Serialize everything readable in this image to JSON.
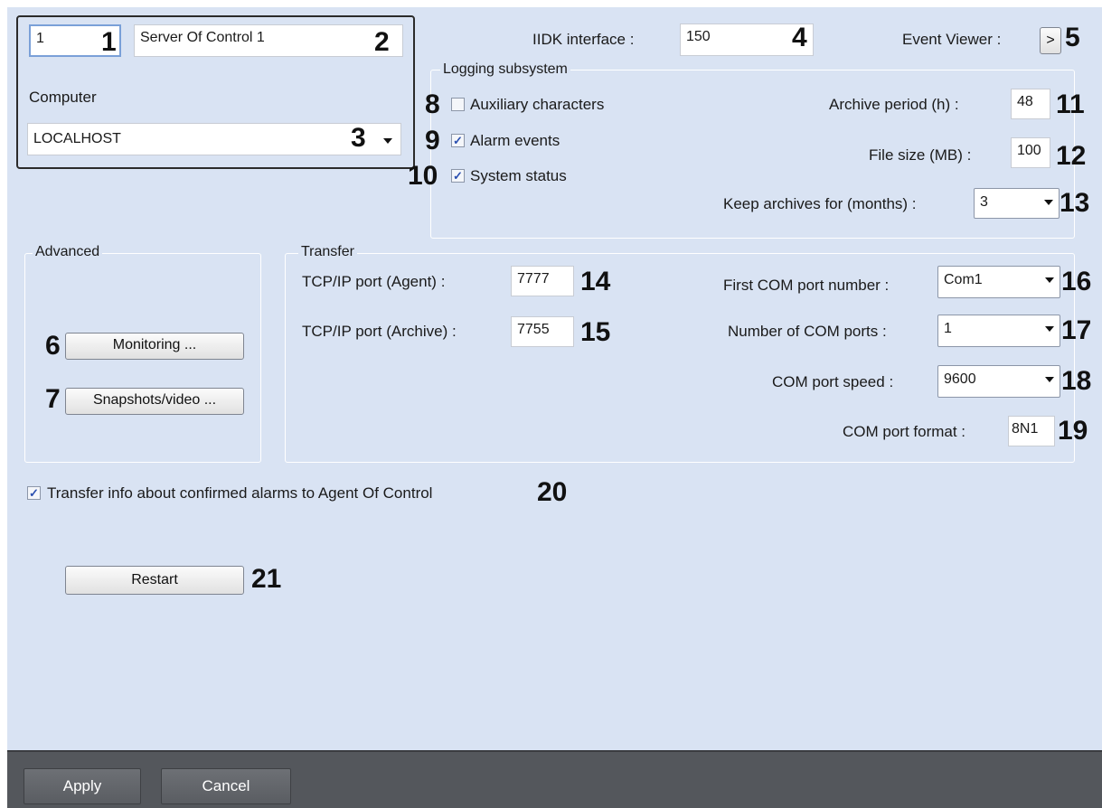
{
  "server": {
    "id_value": "1",
    "name_value": "Server Of Control 1",
    "computer_label": "Computer",
    "computer_value": "LOCALHOST"
  },
  "iidk": {
    "label": "IIDK interface :",
    "value": "150"
  },
  "event_viewer": {
    "label": "Event Viewer :",
    "button_label": ">"
  },
  "logging": {
    "title": "Logging subsystem",
    "auxiliary_label": "Auxiliary characters",
    "auxiliary_checked": false,
    "alarm_label": "Alarm events",
    "alarm_checked": true,
    "system_label": "System status",
    "system_checked": true,
    "archive_period_label": "Archive period (h) :",
    "archive_period_value": "48",
    "file_size_label": "File size (MB) :",
    "file_size_value": "100",
    "keep_archives_label": "Keep archives for (months) :",
    "keep_archives_value": "3"
  },
  "advanced": {
    "title": "Advanced",
    "monitoring_label": "Monitoring ...",
    "snapshots_label": "Snapshots/video ..."
  },
  "transfer": {
    "title": "Transfer",
    "agent_port_label": "TCP/IP port (Agent) :",
    "agent_port_value": "7777",
    "archive_port_label": "TCP/IP port (Archive) :",
    "archive_port_value": "7755",
    "first_com_label": "First COM port number :",
    "first_com_value": "Com1",
    "num_com_label": "Number of COM ports :",
    "num_com_value": "1",
    "com_speed_label": "COM port speed :",
    "com_speed_value": "9600",
    "com_format_label": "COM port format :",
    "com_format_value": "8N1"
  },
  "confirmed_alarms": {
    "label": "Transfer info about confirmed alarms to Agent Of Control",
    "checked": true
  },
  "restart_label": "Restart",
  "footer": {
    "apply_label": "Apply",
    "cancel_label": "Cancel"
  },
  "callouts": [
    "1",
    "2",
    "3",
    "4",
    "5",
    "6",
    "7",
    "8",
    "9",
    "10",
    "11",
    "12",
    "13",
    "14",
    "15",
    "16",
    "17",
    "18",
    "19",
    "20",
    "21"
  ],
  "colors": {
    "panel_bg": "#d9e3f3",
    "footer_bg": "#54575c",
    "check_color": "#2a4fb0"
  }
}
